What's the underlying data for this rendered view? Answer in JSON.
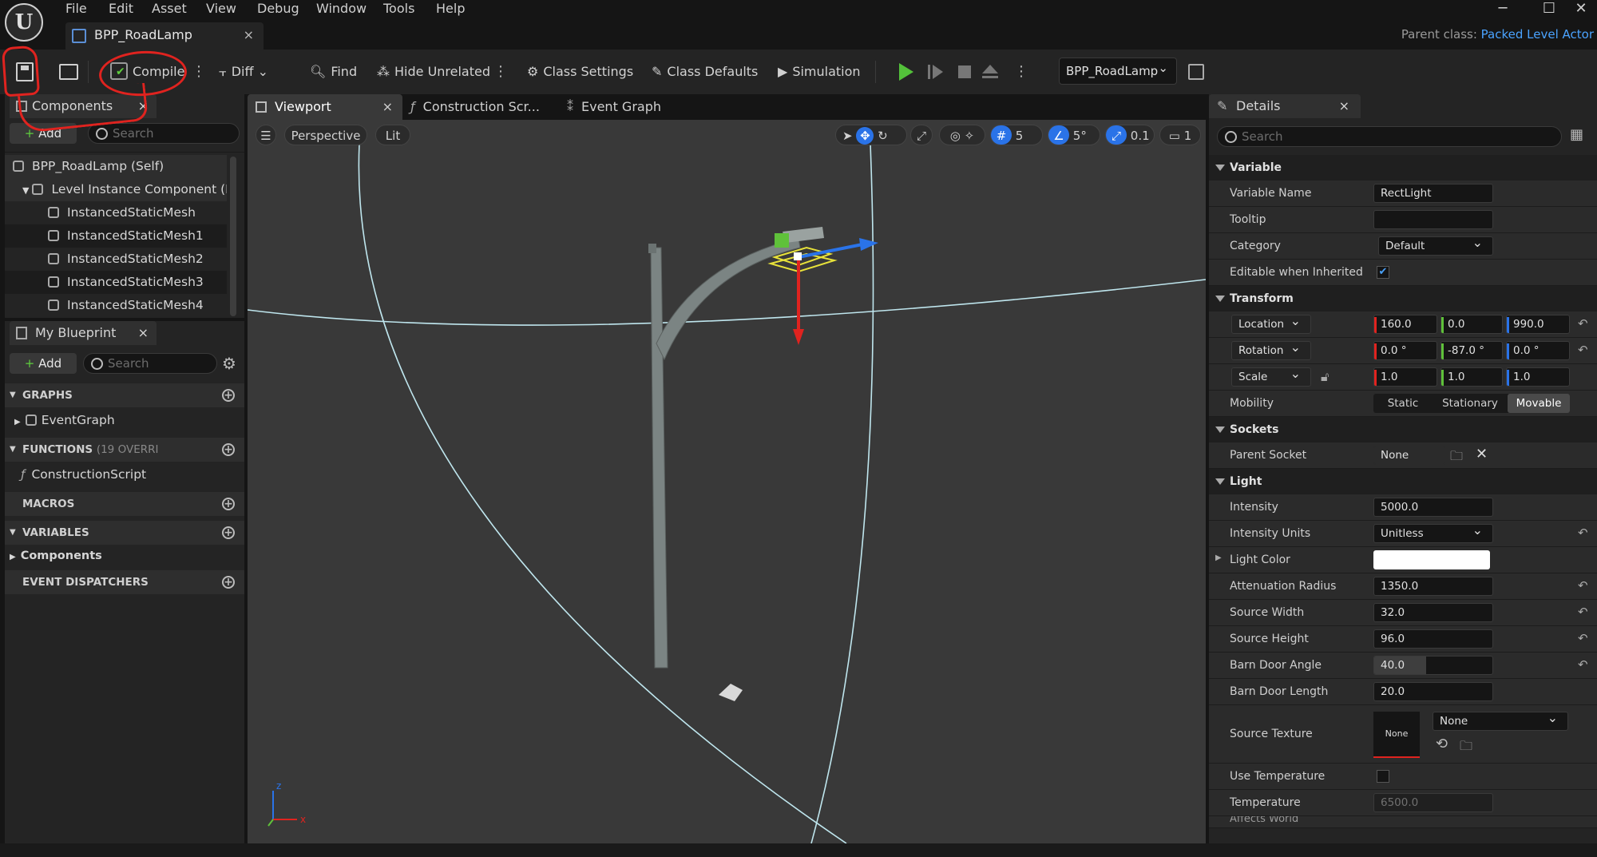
{
  "menu": [
    "File",
    "Edit",
    "Asset",
    "View",
    "Debug",
    "Window",
    "Tools",
    "Help"
  ],
  "window_controls": {
    "minimize": "─",
    "maximize": "☐",
    "close": "✕"
  },
  "asset_tab": {
    "label": "BPP_RoadLamp",
    "close": "×"
  },
  "parent_class": {
    "label": "Parent class:",
    "value": "Packed Level Actor"
  },
  "toolbar": {
    "compile": "Compile",
    "diff": "Diff",
    "find": "Find",
    "hide_unrelated": "Hide Unrelated",
    "class_settings": "Class Settings",
    "class_defaults": "Class Defaults",
    "simulation": "Simulation",
    "debug_object": "BPP_RoadLamp"
  },
  "components_panel": {
    "title": "Components",
    "add": "Add",
    "search_placeholder": "Search",
    "items": [
      "BPP_RoadLamp (Self)",
      "Level Instance Component (Ro",
      "InstancedStaticMesh",
      "InstancedStaticMesh1",
      "InstancedStaticMesh2",
      "InstancedStaticMesh3",
      "InstancedStaticMesh4"
    ]
  },
  "my_blueprint": {
    "title": "My Blueprint",
    "add": "Add",
    "search_placeholder": "Search",
    "graphs": "GRAPHS",
    "event_graph": "EventGraph",
    "functions": "FUNCTIONS",
    "functions_note": "(19 OVERRI",
    "construction_script": "ConstructionScript",
    "macros": "MACROS",
    "variables": "VARIABLES",
    "components": "Components",
    "event_dispatchers": "EVENT DISPATCHERS"
  },
  "editor_tabs": {
    "viewport": "Viewport",
    "construction": "Construction Scr...",
    "event_graph": "Event Graph"
  },
  "viewport_toolbar": {
    "perspective": "Perspective",
    "lit": "Lit",
    "grid": "5",
    "angle": "5°",
    "scale": "0.1",
    "camera": "1"
  },
  "details": {
    "title": "Details",
    "search_placeholder": "Search",
    "sections": {
      "variable": "Variable",
      "transform": "Transform",
      "sockets": "Sockets",
      "light": "Light"
    },
    "variable_name": {
      "label": "Variable Name",
      "value": "RectLight"
    },
    "tooltip": {
      "label": "Tooltip",
      "value": ""
    },
    "category": {
      "label": "Category",
      "value": "Default"
    },
    "editable_inherited": {
      "label": "Editable when Inherited",
      "checked": true
    },
    "location": {
      "label": "Location",
      "x": "160.0",
      "y": "0.0",
      "z": "990.0"
    },
    "rotation": {
      "label": "Rotation",
      "x": "0.0 °",
      "y": "-87.0 °",
      "z": "0.0 °"
    },
    "scale": {
      "label": "Scale",
      "x": "1.0",
      "y": "1.0",
      "z": "1.0"
    },
    "mobility": {
      "label": "Mobility",
      "options": [
        "Static",
        "Stationary",
        "Movable"
      ],
      "selected": "Movable"
    },
    "parent_socket": {
      "label": "Parent Socket",
      "value": "None"
    },
    "intensity": {
      "label": "Intensity",
      "value": "5000.0"
    },
    "intensity_units": {
      "label": "Intensity Units",
      "value": "Unitless"
    },
    "light_color": {
      "label": "Light Color",
      "value": "#ffffff"
    },
    "attenuation_radius": {
      "label": "Attenuation Radius",
      "value": "1350.0"
    },
    "source_width": {
      "label": "Source Width",
      "value": "32.0"
    },
    "source_height": {
      "label": "Source Height",
      "value": "96.0"
    },
    "barn_door_angle": {
      "label": "Barn Door Angle",
      "value": "40.0",
      "fill": 0.44
    },
    "barn_door_length": {
      "label": "Barn Door Length",
      "value": "20.0"
    },
    "source_texture": {
      "label": "Source Texture",
      "thumb": "None",
      "value": "None"
    },
    "use_temperature": {
      "label": "Use Temperature",
      "checked": false
    },
    "temperature": {
      "label": "Temperature",
      "value": "6500.0"
    },
    "affects_world": {
      "label": "Affects World"
    }
  },
  "colors": {
    "accent": "#4aa3ff",
    "annotation": "#e0231f",
    "bg": "#242424",
    "viewport": "#393939"
  }
}
